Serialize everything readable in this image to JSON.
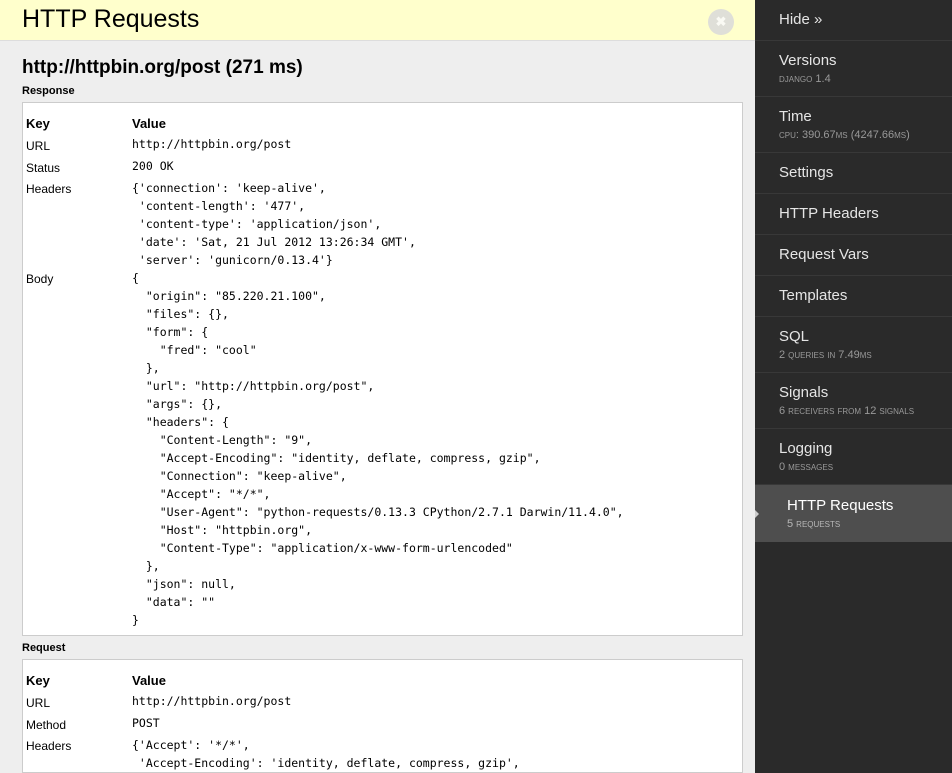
{
  "panel": {
    "title": "HTTP Requests",
    "close_label": "✖",
    "request_heading": "http://httpbin.org/post (271 ms)",
    "response_label": "Response",
    "request_label": "Request",
    "table_headers": {
      "key": "Key",
      "value": "Value"
    },
    "response": {
      "url_key": "URL",
      "url_value": "http://httpbin.org/post",
      "status_key": "Status",
      "status_value": "200 OK",
      "headers_key": "Headers",
      "headers_value": "{'connection': 'keep-alive',\n 'content-length': '477',\n 'content-type': 'application/json',\n 'date': 'Sat, 21 Jul 2012 13:26:34 GMT',\n 'server': 'gunicorn/0.13.4'}",
      "body_key": "Body",
      "body_value": "{\n  \"origin\": \"85.220.21.100\",\n  \"files\": {},\n  \"form\": {\n    \"fred\": \"cool\"\n  },\n  \"url\": \"http://httpbin.org/post\",\n  \"args\": {},\n  \"headers\": {\n    \"Content-Length\": \"9\",\n    \"Accept-Encoding\": \"identity, deflate, compress, gzip\",\n    \"Connection\": \"keep-alive\",\n    \"Accept\": \"*/*\",\n    \"User-Agent\": \"python-requests/0.13.3 CPython/2.7.1 Darwin/11.4.0\",\n    \"Host\": \"httpbin.org\",\n    \"Content-Type\": \"application/x-www-form-urlencoded\"\n  },\n  \"json\": null,\n  \"data\": \"\"\n}"
    },
    "request": {
      "url_key": "URL",
      "url_value": "http://httpbin.org/post",
      "method_key": "Method",
      "method_value": "POST",
      "headers_key": "Headers",
      "headers_value": "{'Accept': '*/*',\n 'Accept-Encoding': 'identity, deflate, compress, gzip',"
    }
  },
  "sidebar": {
    "hide": {
      "label": "Hide »"
    },
    "items": [
      {
        "label": "Versions",
        "sub": "Django 1.4",
        "active": false
      },
      {
        "label": "Time",
        "sub": "CPU: 390.67ms (4247.66ms)",
        "active": false
      },
      {
        "label": "Settings",
        "sub": "",
        "active": false
      },
      {
        "label": "HTTP Headers",
        "sub": "",
        "active": false
      },
      {
        "label": "Request Vars",
        "sub": "",
        "active": false
      },
      {
        "label": "Templates",
        "sub": "",
        "active": false
      },
      {
        "label": "SQL",
        "sub": "2 queries in 7.49ms",
        "active": false
      },
      {
        "label": "Signals",
        "sub": "6 receivers from 12 signals",
        "active": false
      },
      {
        "label": "Logging",
        "sub": "0 messages",
        "active": false
      },
      {
        "label": "HTTP Requests",
        "sub": "5 requests",
        "active": true
      }
    ]
  },
  "colors": {
    "header_yellow": "#ffffcc",
    "panel_gray": "#eeeeee",
    "sidebar_dark": "#2a2a2a",
    "sidebar_active": "#4e4e4e",
    "arrow": "#cccccc"
  }
}
